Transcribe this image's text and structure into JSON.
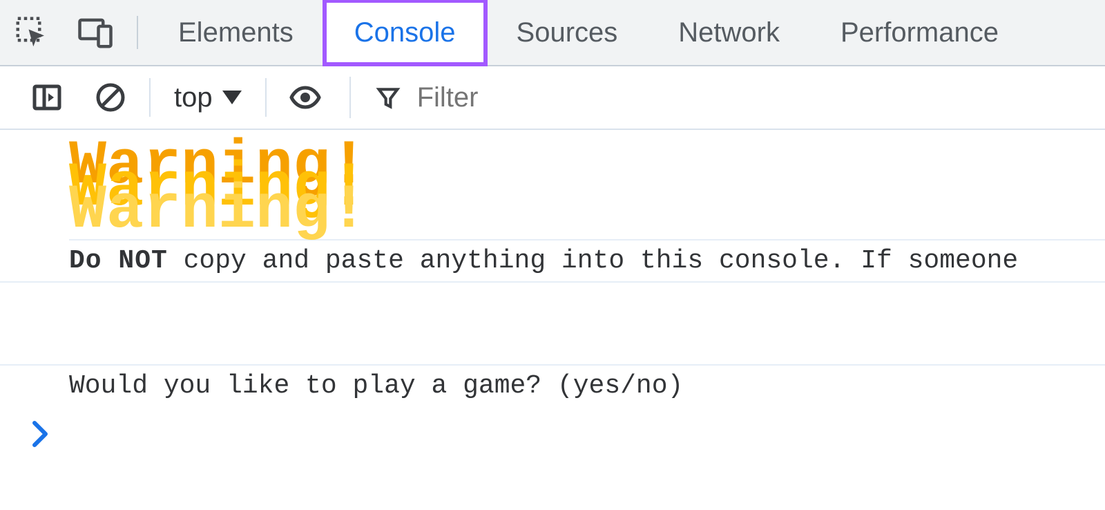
{
  "tabs": {
    "elements": "Elements",
    "console": "Console",
    "sources": "Sources",
    "network": "Network",
    "performance": "Performance"
  },
  "toolbar": {
    "context_label": "top",
    "filter_placeholder": "Filter"
  },
  "console_messages": {
    "warning_text": "Warning!",
    "donot_bold": "Do NOT",
    "donot_rest": " copy and paste anything into this console.  If someone ",
    "game_prompt": "Would you like to play a game? (yes/no)"
  }
}
